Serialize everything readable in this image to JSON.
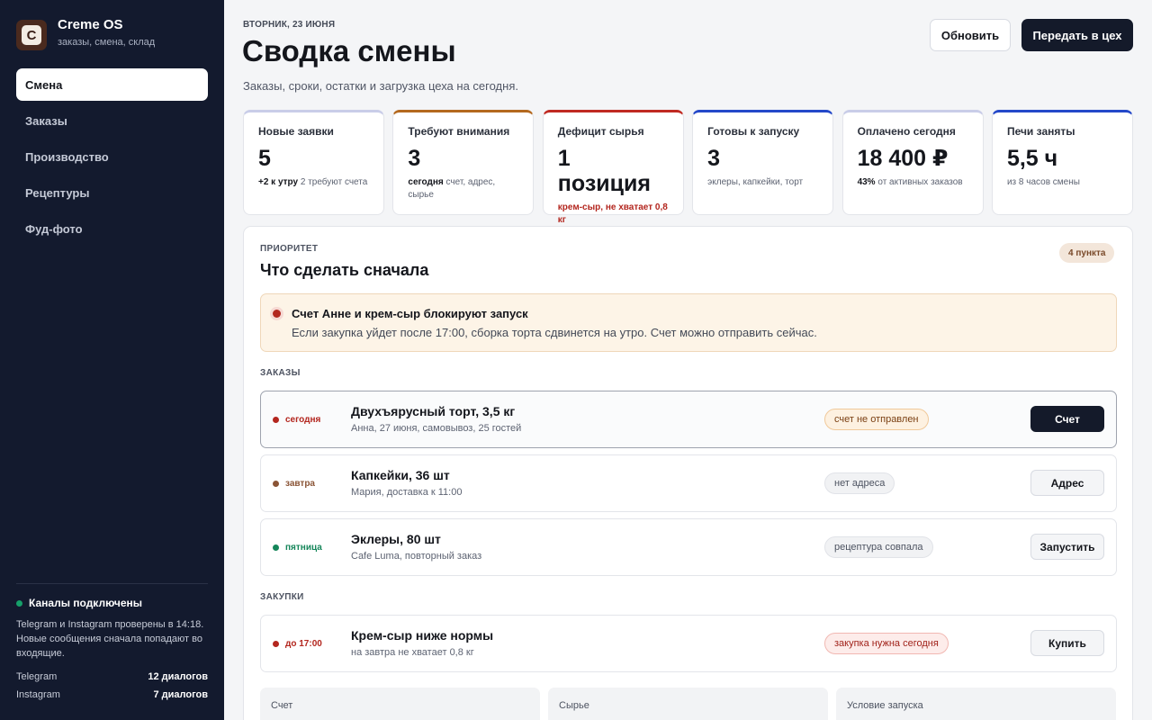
{
  "sidebar": {
    "brand": {
      "logo_letter": "C",
      "title": "Creme OS",
      "subtitle": "заказы, смена, склад"
    },
    "nav": [
      {
        "label": "Смена",
        "active": true
      },
      {
        "label": "Заказы",
        "active": false
      },
      {
        "label": "Производство",
        "active": false
      },
      {
        "label": "Рецептуры",
        "active": false
      },
      {
        "label": "Фуд-фото",
        "active": false
      }
    ],
    "channels": {
      "heading": "Каналы подключены",
      "text": "Telegram и Instagram проверены в 14:18. Новые сообщения сначала попадают во входящие.",
      "items": [
        {
          "name": "Telegram",
          "value": "12 диалогов"
        },
        {
          "name": "Instagram",
          "value": "7 диалогов"
        }
      ]
    }
  },
  "header": {
    "date": "ВТОРНИК, 23 ИЮНЯ",
    "title": "Сводка смены",
    "subtitle": "Заказы, сроки, остатки и загрузка цеха на сегодня.",
    "refresh_label": "Обновить",
    "send_label": "Передать в цех"
  },
  "kpis": [
    {
      "label": "Новые заявки",
      "value": "5",
      "note_bold": "+2 к утру",
      "note": " 2 требуют счета",
      "accent": "#c9cde8",
      "warn": false
    },
    {
      "label": "Требуют внимания",
      "value": "3",
      "note_bold": "сегодня",
      "note": " счет, адрес, сырье",
      "accent": "#b4691f",
      "warn": false
    },
    {
      "label": "Дефицит сырья",
      "value": "1 позиция",
      "note_bold": "",
      "note": "крем-сыр, не хватает 0,8 кг",
      "accent": "#c02a22",
      "warn": true
    },
    {
      "label": "Готовы к запуску",
      "value": "3",
      "note_bold": "",
      "note": "эклеры, капкейки, торт",
      "accent": "#2448c9",
      "warn": false
    },
    {
      "label": "Оплачено сегодня",
      "value": "18 400 ₽",
      "note_bold": "43%",
      "note": " от активных заказов",
      "accent": "#c9cde8",
      "warn": false
    },
    {
      "label": "Печи заняты",
      "value": "5,5 ч",
      "note_bold": "",
      "note": "из 8 часов смены",
      "accent": "#2448c9",
      "warn": false
    }
  ],
  "priority": {
    "section_label": "ПРИОРИТЕТ",
    "title": "Что сделать сначала",
    "badge": "4 пункта",
    "alert": {
      "title": "Счет Анне и крем-сыр блокируют запуск",
      "text": "Если закупка уйдет после 17:00, сборка торта сдвинется на утро. Счет можно отправить сейчас."
    },
    "orders_label": "ЗАКАЗЫ",
    "orders": [
      {
        "when": "сегодня",
        "when_color": "#b3261e",
        "title": "Двухъярусный торт, 3,5 кг",
        "sub": "Анна, 27 июня, самовывоз, 25 гостей",
        "tag": "счет не отправлен",
        "tag_style": "amber",
        "action": "Счет",
        "dark": true,
        "selected": true
      },
      {
        "when": "завтра",
        "when_color": "#8a5436",
        "title": "Капкейки, 36 шт",
        "sub": "Мария, доставка к 11:00",
        "tag": "нет адреса",
        "tag_style": "grey",
        "action": "Адрес",
        "dark": false,
        "selected": false
      },
      {
        "when": "пятница",
        "when_color": "#15865a",
        "title": "Эклеры, 80 шт",
        "sub": "Cafe Luma, повторный заказ",
        "tag": "рецептура совпала",
        "tag_style": "grey",
        "action": "Запустить",
        "dark": false,
        "selected": false
      }
    ],
    "purchases_label": "ЗАКУПКИ",
    "purchases": [
      {
        "when": "до 17:00",
        "when_color": "#b3261e",
        "title": "Крем-сыр ниже нормы",
        "sub": "на завтра не хватает 0,8 кг",
        "tag": "закупка нужна сегодня",
        "tag_style": "red",
        "action": "Купить",
        "dark": false,
        "selected": false
      }
    ],
    "mini_cards": [
      "Счет",
      "Сырье",
      "Условие запуска"
    ]
  }
}
